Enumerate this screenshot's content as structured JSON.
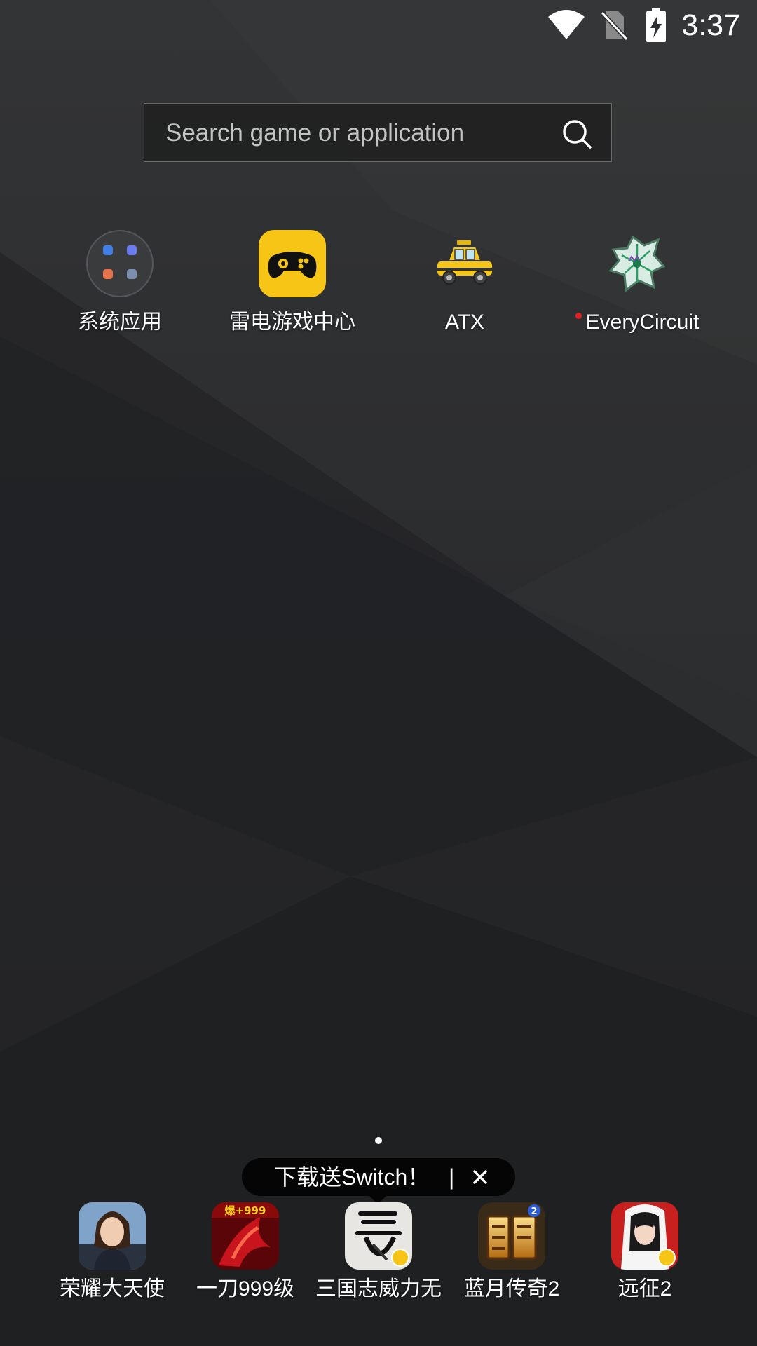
{
  "status_bar": {
    "time": "3:37",
    "icons": [
      "wifi-icon",
      "no-sim-icon",
      "battery-charging-icon"
    ]
  },
  "search": {
    "placeholder": "Search game or application",
    "icon": "search-icon"
  },
  "home_apps": [
    {
      "label": "系统应用",
      "icon": "folder-icon",
      "new": false
    },
    {
      "label": "雷电游戏中心",
      "icon": "gamepad-icon",
      "new": false
    },
    {
      "label": "ATX",
      "icon": "taxi-icon",
      "new": false
    },
    {
      "label": "EveryCircuit",
      "icon": "circuit-icon",
      "new": true
    }
  ],
  "page_indicator": {
    "current": 1,
    "total": 1
  },
  "promo": {
    "text": "下载送Switch！",
    "separator": "|",
    "close_icon": "close-icon"
  },
  "dock": [
    {
      "label": "荣耀大天使",
      "icon": "game-portrait-icon"
    },
    {
      "label": "一刀999级",
      "icon": "game-dragon-icon",
      "badge_text": "爆+999"
    },
    {
      "label": "三国志威力无",
      "icon": "game-calligraphy-icon"
    },
    {
      "label": "蓝月传奇2",
      "icon": "game-bluemoon-icon"
    },
    {
      "label": "远征2",
      "icon": "game-heroine-icon"
    }
  ],
  "colors": {
    "accent_yellow": "#f7c515",
    "new_dot": "#e02020",
    "promo_bg": "#050505"
  }
}
